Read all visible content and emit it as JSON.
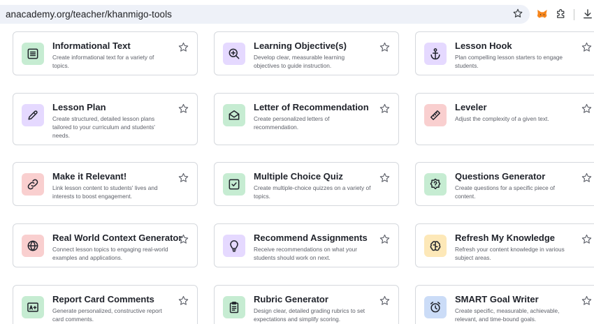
{
  "browser": {
    "url": "anacademy.org/teacher/khanmigo-tools",
    "icons": [
      "bookmark-star-icon",
      "metamask-fox-icon",
      "extensions-puzzle-icon",
      "download-icon"
    ]
  },
  "colors": {
    "green": "#c6ecd2",
    "purple": "#e5d9ff",
    "red": "#f9cfcf",
    "yellow": "#fde8b8",
    "blue": "#cbdcf7",
    "text": "#21242c",
    "muted": "#5d6069"
  },
  "tools": [
    {
      "title": "Informational Text",
      "desc": "Create informational text for a variety of topics.",
      "icon": "text-document-icon",
      "color": "green"
    },
    {
      "title": "Learning Objective(s)",
      "desc": "Develop clear, measurable learning objectives to guide instruction.",
      "icon": "zoom-plus-icon",
      "color": "purple"
    },
    {
      "title": "Lesson Hook",
      "desc": "Plan compelling lesson starters to engage students.",
      "icon": "anchor-icon",
      "color": "purple"
    },
    {
      "title": "Lesson Plan",
      "desc": "Create structured, detailed lesson plans tailored to your curriculum and students' needs.",
      "icon": "pencil-icon",
      "color": "purple"
    },
    {
      "title": "Letter of Recommendation",
      "desc": "Create personalized letters of recommendation.",
      "icon": "envelope-icon",
      "color": "green"
    },
    {
      "title": "Leveler",
      "desc": "Adjust the complexity of a given text.",
      "icon": "ruler-icon",
      "color": "red"
    },
    {
      "title": "Make it Relevant!",
      "desc": "Link lesson content to students' lives and interests to boost engagement.",
      "icon": "link-icon",
      "color": "red"
    },
    {
      "title": "Multiple Choice Quiz",
      "desc": "Create multiple-choice quizzes on a variety of topics.",
      "icon": "checkbox-icon",
      "color": "green"
    },
    {
      "title": "Questions Generator",
      "desc": "Create questions for a specific piece of content.",
      "icon": "question-badge-icon",
      "color": "green"
    },
    {
      "title": "Real World Context Generator",
      "desc": "Connect lesson topics to engaging real-world examples and applications.",
      "icon": "globe-icon",
      "color": "red"
    },
    {
      "title": "Recommend Assignments",
      "desc": "Receive recommendations on what your students should work on next.",
      "icon": "lightbulb-icon",
      "color": "purple"
    },
    {
      "title": "Refresh My Knowledge",
      "desc": "Refresh your content knowledge in various subject areas.",
      "icon": "brain-icon",
      "color": "yellow"
    },
    {
      "title": "Report Card Comments",
      "desc": "Generate personalized, constructive report card comments.",
      "icon": "grade-card-icon",
      "color": "green"
    },
    {
      "title": "Rubric Generator",
      "desc": "Design clear, detailed grading rubrics to set expectations and simplify scoring.",
      "icon": "clipboard-icon",
      "color": "green"
    },
    {
      "title": "SMART Goal Writer",
      "desc": "Create specific, measurable, achievable, relevant, and time-bound goals.",
      "icon": "alarm-clock-icon",
      "color": "blue"
    }
  ]
}
